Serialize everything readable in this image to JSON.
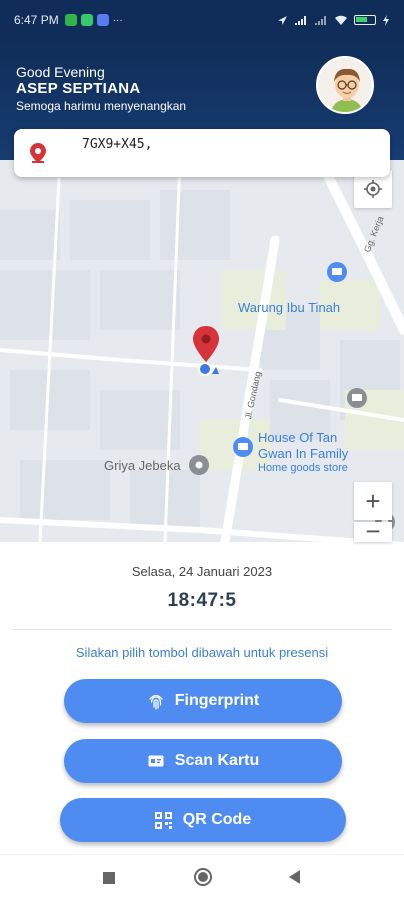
{
  "status_bar": {
    "time": "6:47 PM",
    "battery_icon": "battery-icon",
    "wifi_icon": "wifi-icon",
    "signal_icon": "signal-icon"
  },
  "header": {
    "greeting": "Good Evening",
    "user_name": "ASEP SEPTIANA",
    "tagline": "Semoga harimu menyenangkan",
    "avatar_icon": "user-avatar"
  },
  "search": {
    "location_code": "7GX9+X45,"
  },
  "map": {
    "places": {
      "warung": "Warung Ibu Tinah",
      "house_line1": "House Of Tan",
      "house_line2": "Gwan In Family",
      "house_sub": "Home goods store",
      "griya": "Griya Jebeka"
    },
    "streets": {
      "gg": "Gg. Kerja",
      "jl": "Jl. Gondang"
    },
    "zoom_in": "+",
    "zoom_out": "−"
  },
  "panel": {
    "date": "Selasa, 24 Januari 2023",
    "clock": "18:47:5",
    "instruction": "Silakan pilih tombol dibawah untuk presensi",
    "buttons": {
      "fingerprint": "Fingerprint",
      "scan_card": "Scan Kartu",
      "qr_code": "QR Code"
    }
  },
  "colors": {
    "header": "#0f2d58",
    "accent": "#4f8cf2",
    "marker": "#d6343a"
  }
}
